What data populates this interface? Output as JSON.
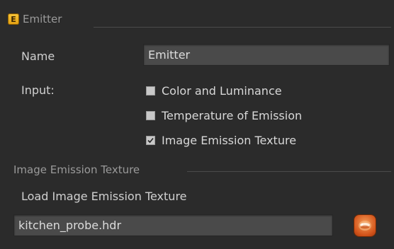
{
  "group": {
    "badge": "E",
    "title": "Emitter"
  },
  "name": {
    "label": "Name",
    "value": "Emitter"
  },
  "input": {
    "label": "Input:",
    "options": [
      {
        "label": "Color and Luminance",
        "checked": false
      },
      {
        "label": "Temperature of Emission",
        "checked": false
      },
      {
        "label": "Image Emission Texture",
        "checked": true
      }
    ]
  },
  "texture_section": {
    "title": "Image Emission Texture",
    "load_label": "Load Image Emission Texture",
    "file_value": "kitchen_probe.hdr",
    "browse_icon": "texture-browse-icon"
  },
  "colors": {
    "badge": "#f2b622",
    "browse_button": "#e0662a",
    "panel_bg": "#2b2b2b",
    "field_bg": "#4a4a4a"
  }
}
